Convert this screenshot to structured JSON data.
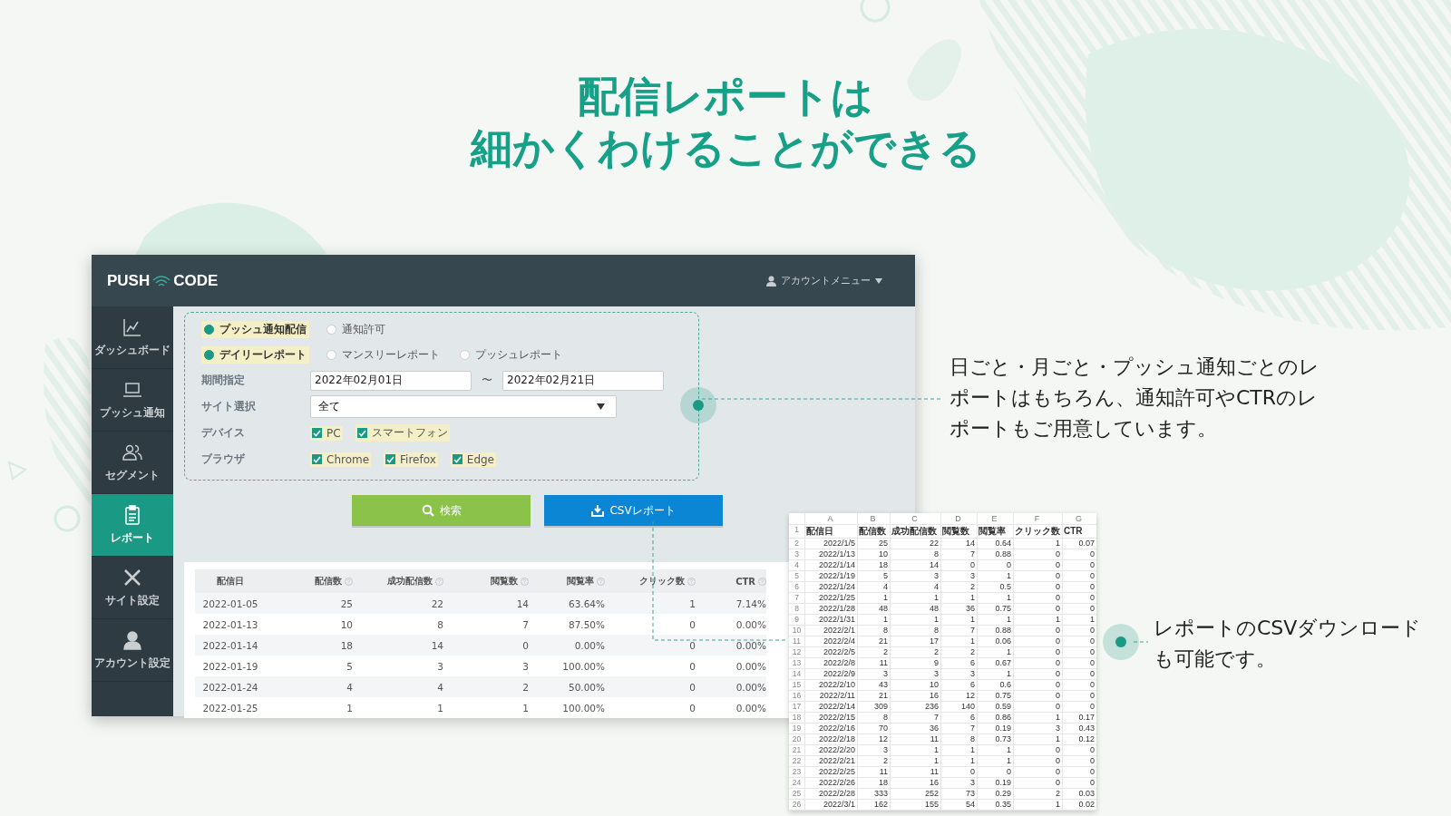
{
  "heading": [
    "配信レポートは",
    "細かくわけることができる"
  ],
  "app": {
    "logo": {
      "left": "PUSH",
      "right": "CODE"
    },
    "account_menu": "アカウントメニュー",
    "sidebar": {
      "items": [
        {
          "label": "ダッシュボード",
          "selected": false
        },
        {
          "label": "プッシュ通知",
          "selected": false
        },
        {
          "label": "セグメント",
          "selected": false
        },
        {
          "label": "レポート",
          "selected": true
        },
        {
          "label": "サイト設定",
          "selected": false
        },
        {
          "label": "アカウント設定",
          "selected": false
        }
      ]
    },
    "filters": {
      "source": [
        {
          "label": "プッシュ通知配信",
          "selected": true
        },
        {
          "label": "通知許可",
          "selected": false
        }
      ],
      "report_type": [
        {
          "label": "デイリーレポート",
          "selected": true
        },
        {
          "label": "マンスリーレポート",
          "selected": false
        },
        {
          "label": "プッシュレポート",
          "selected": false
        }
      ],
      "period": {
        "label": "期間指定",
        "start": "2022年02月01日",
        "separator": "〜",
        "end": "2022年02月21日"
      },
      "site": {
        "label": "サイト選択",
        "value": "全て"
      },
      "device": {
        "label": "デバイス",
        "options": [
          {
            "label": "PC",
            "checked": true
          },
          {
            "label": "スマートフォン",
            "checked": true
          }
        ]
      },
      "browser": {
        "label": "ブラウザ",
        "options": [
          {
            "label": "Chrome",
            "checked": true
          },
          {
            "label": "Firefox",
            "checked": true
          },
          {
            "label": "Edge",
            "checked": true
          }
        ]
      }
    },
    "buttons": {
      "search": "検索",
      "csv": "CSVレポート"
    },
    "table": {
      "columns": [
        "配信日",
        "配信数",
        "成功配信数",
        "閲覧数",
        "閲覧率",
        "クリック数",
        "CTR"
      ],
      "rows": [
        [
          "2022-01-05",
          "25",
          "22",
          "14",
          "63.64%",
          "1",
          "7.14%"
        ],
        [
          "2022-01-13",
          "10",
          "8",
          "7",
          "87.50%",
          "0",
          "0.00%"
        ],
        [
          "2022-01-14",
          "18",
          "14",
          "0",
          "0.00%",
          "0",
          "0.00%"
        ],
        [
          "2022-01-19",
          "5",
          "3",
          "3",
          "100.00%",
          "0",
          "0.00%"
        ],
        [
          "2022-01-24",
          "4",
          "4",
          "2",
          "50.00%",
          "0",
          "0.00%"
        ],
        [
          "2022-01-25",
          "1",
          "1",
          "1",
          "100.00%",
          "0",
          "0.00%"
        ]
      ]
    }
  },
  "spreadsheet": {
    "column_letters": [
      "A",
      "B",
      "C",
      "D",
      "E",
      "F",
      "G"
    ],
    "rows": [
      {
        "number": "1",
        "cells": [
          "配信日",
          "配信数",
          "成功配信数",
          "閲覧数",
          "閲覧率",
          "クリック数",
          "CTR"
        ]
      },
      {
        "number": "2",
        "cells": [
          "2022/1/5",
          "25",
          "22",
          "14",
          "0.64",
          "1",
          "0.07"
        ]
      },
      {
        "number": "3",
        "cells": [
          "2022/1/13",
          "10",
          "8",
          "7",
          "0.88",
          "0",
          "0"
        ]
      },
      {
        "number": "4",
        "cells": [
          "2022/1/14",
          "18",
          "14",
          "0",
          "0",
          "0",
          "0"
        ]
      },
      {
        "number": "5",
        "cells": [
          "2022/1/19",
          "5",
          "3",
          "3",
          "1",
          "0",
          "0"
        ]
      },
      {
        "number": "6",
        "cells": [
          "2022/1/24",
          "4",
          "4",
          "2",
          "0.5",
          "0",
          "0"
        ]
      },
      {
        "number": "7",
        "cells": [
          "2022/1/25",
          "1",
          "1",
          "1",
          "1",
          "0",
          "0"
        ]
      },
      {
        "number": "8",
        "cells": [
          "2022/1/28",
          "48",
          "48",
          "36",
          "0.75",
          "0",
          "0"
        ]
      },
      {
        "number": "9",
        "cells": [
          "2022/1/31",
          "1",
          "1",
          "1",
          "1",
          "1",
          "1"
        ]
      },
      {
        "number": "10",
        "cells": [
          "2022/2/1",
          "8",
          "8",
          "7",
          "0.88",
          "0",
          "0"
        ]
      },
      {
        "number": "11",
        "cells": [
          "2022/2/4",
          "21",
          "17",
          "1",
          "0.06",
          "0",
          "0"
        ]
      },
      {
        "number": "12",
        "cells": [
          "2022/2/5",
          "2",
          "2",
          "2",
          "1",
          "0",
          "0"
        ]
      },
      {
        "number": "13",
        "cells": [
          "2022/2/8",
          "11",
          "9",
          "6",
          "0.67",
          "0",
          "0"
        ]
      },
      {
        "number": "14",
        "cells": [
          "2022/2/9",
          "3",
          "3",
          "3",
          "1",
          "0",
          "0"
        ]
      },
      {
        "number": "15",
        "cells": [
          "2022/2/10",
          "43",
          "10",
          "6",
          "0.6",
          "0",
          "0"
        ]
      },
      {
        "number": "16",
        "cells": [
          "2022/2/11",
          "21",
          "16",
          "12",
          "0.75",
          "0",
          "0"
        ]
      },
      {
        "number": "17",
        "cells": [
          "2022/2/14",
          "309",
          "236",
          "140",
          "0.59",
          "0",
          "0"
        ]
      },
      {
        "number": "18",
        "cells": [
          "2022/2/15",
          "8",
          "7",
          "6",
          "0.86",
          "1",
          "0.17"
        ]
      },
      {
        "number": "19",
        "cells": [
          "2022/2/16",
          "70",
          "36",
          "7",
          "0.19",
          "3",
          "0.43"
        ]
      },
      {
        "number": "20",
        "cells": [
          "2022/2/18",
          "12",
          "11",
          "8",
          "0.73",
          "1",
          "0.12"
        ]
      },
      {
        "number": "21",
        "cells": [
          "2022/2/20",
          "3",
          "1",
          "1",
          "1",
          "0",
          "0"
        ]
      },
      {
        "number": "22",
        "cells": [
          "2022/2/21",
          "2",
          "1",
          "1",
          "1",
          "0",
          "0"
        ]
      },
      {
        "number": "23",
        "cells": [
          "2022/2/25",
          "11",
          "11",
          "0",
          "0",
          "0",
          "0"
        ]
      },
      {
        "number": "24",
        "cells": [
          "2022/2/26",
          "18",
          "16",
          "3",
          "0.19",
          "0",
          "0"
        ]
      },
      {
        "number": "25",
        "cells": [
          "2022/2/28",
          "333",
          "252",
          "73",
          "0.29",
          "2",
          "0.03"
        ]
      },
      {
        "number": "26",
        "cells": [
          "2022/3/1",
          "162",
          "155",
          "54",
          "0.35",
          "1",
          "0.02"
        ]
      }
    ]
  },
  "callouts": [
    {
      "text": "日ごと・月ごと・プッシュ通知ごとのレポートはもちろん、通知許可やCTRのレポートもご用意しています。"
    },
    {
      "text": "レポートのCSVダウンロードも可能です。"
    }
  ]
}
